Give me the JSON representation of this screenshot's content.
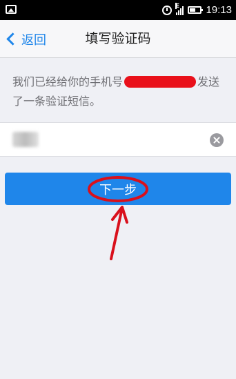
{
  "status_bar": {
    "time": "19:13",
    "network": "E"
  },
  "nav": {
    "back_label": "返回",
    "title": "填写验证码"
  },
  "message": {
    "part1": "我们已经给你的手机号",
    "part2": "发送了一条验证短信。"
  },
  "code_field": {
    "value": ""
  },
  "next_button": {
    "label": "下一步"
  },
  "colors": {
    "accent": "#1f86ea",
    "annotation": "#d9101c",
    "background": "#eff0f5"
  }
}
